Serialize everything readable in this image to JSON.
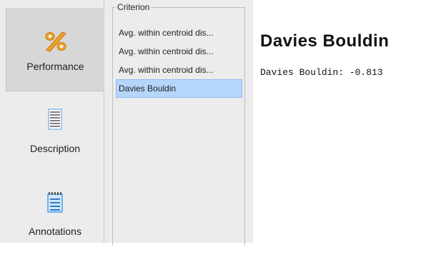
{
  "sidebar": {
    "items": [
      {
        "label": "Performance",
        "icon": "percent-icon"
      },
      {
        "label": "Description",
        "icon": "document-icon"
      },
      {
        "label": "Annotations",
        "icon": "notepad-icon"
      }
    ]
  },
  "criterion": {
    "legend": "Criterion",
    "items": [
      "Avg. within centroid dis...",
      "Avg. within centroid dis...",
      "Avg. within centroid dis...",
      "Davies Bouldin"
    ],
    "selected": "Davies Bouldin"
  },
  "main": {
    "title": "Davies Bouldin",
    "value_text": "Davies Bouldin: -0.813"
  },
  "colors": {
    "selection": "#b5d6fb",
    "icon_orange": "#f0a126",
    "icon_blue": "#4a9ee8"
  }
}
